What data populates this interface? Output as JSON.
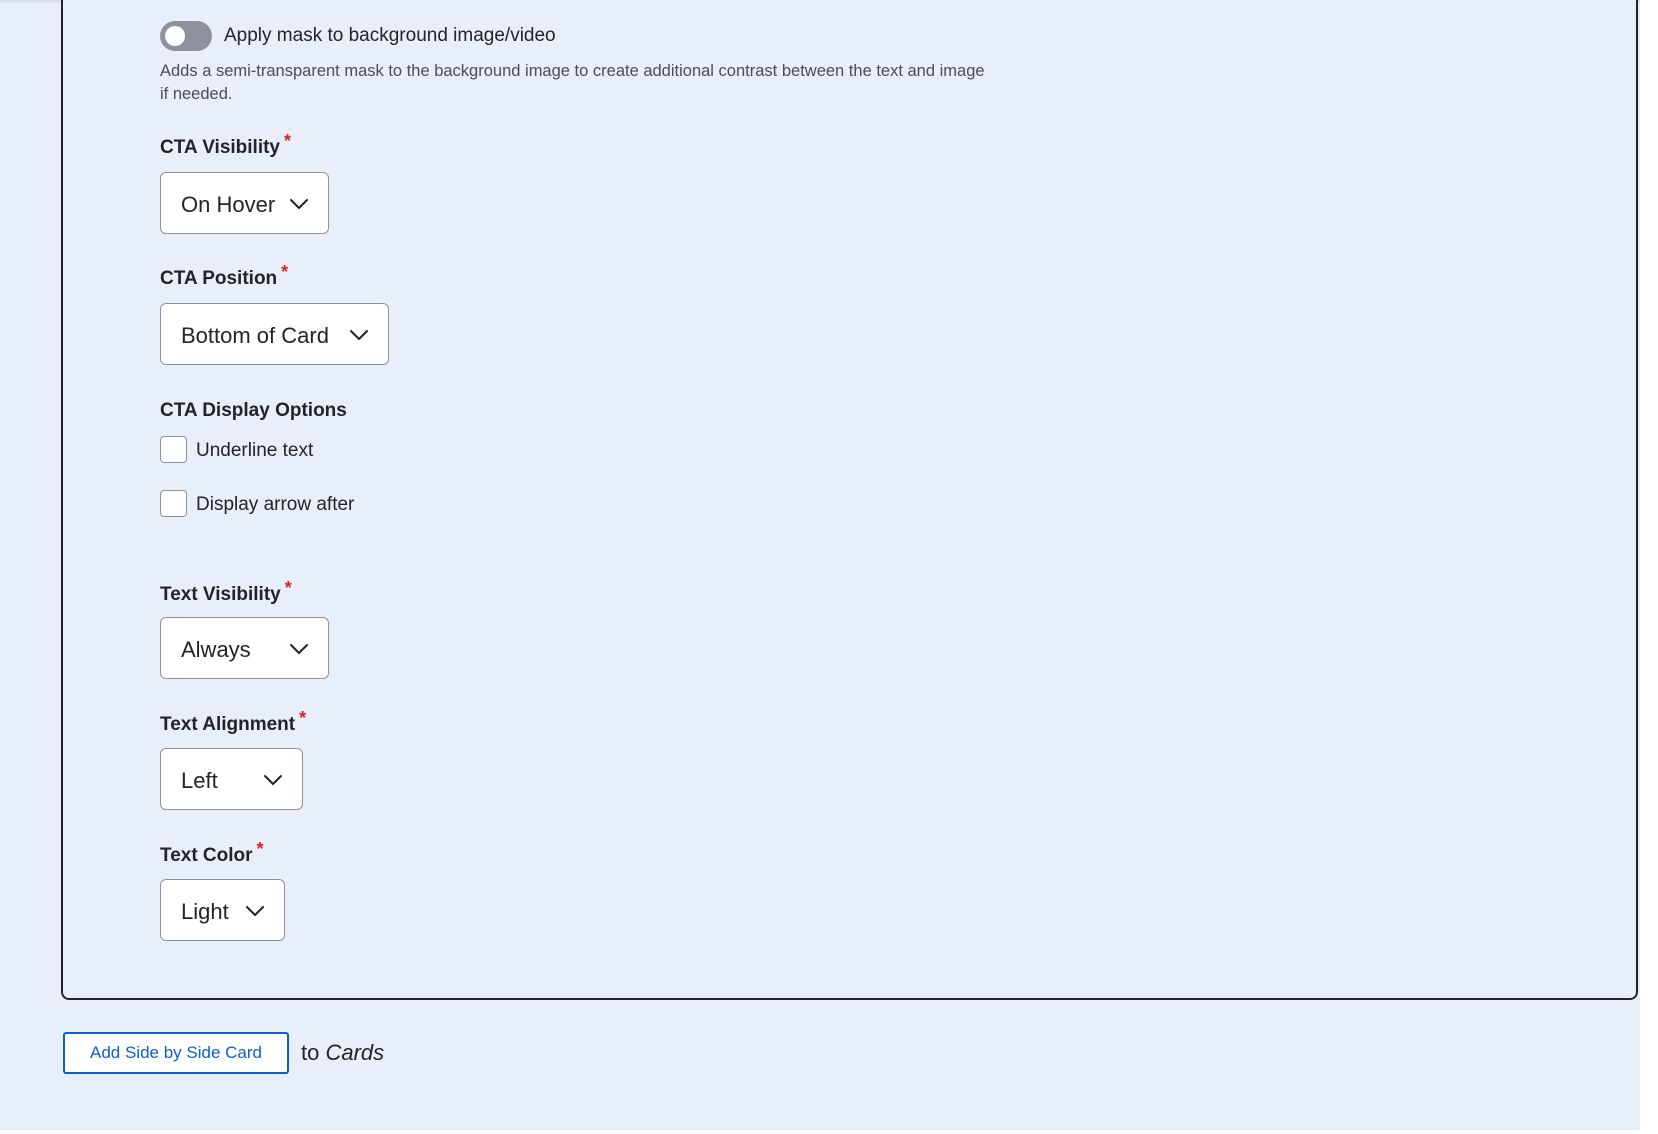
{
  "mask_toggle": {
    "label": "Apply mask to background image/video",
    "enabled": false,
    "description": "Adds a semi-transparent mask to the background image to create additional contrast between the text and image if needed."
  },
  "required_marker": "*",
  "cta_visibility": {
    "label": "CTA Visibility",
    "value": "On Hover"
  },
  "cta_position": {
    "label": "CTA Position",
    "value": "Bottom of Card"
  },
  "cta_display_options": {
    "label": "CTA Display Options",
    "options": [
      {
        "label": "Underline text",
        "checked": false
      },
      {
        "label": "Display arrow after",
        "checked": false
      }
    ]
  },
  "text_visibility": {
    "label": "Text Visibility",
    "value": "Always"
  },
  "text_alignment": {
    "label": "Text Alignment",
    "value": "Left"
  },
  "text_color": {
    "label": "Text Color",
    "value": "Light"
  },
  "add_card": {
    "button_label": "Add Side by Side Card",
    "to_text": "to",
    "target": "Cards"
  },
  "colors": {
    "background": "#e8eefa",
    "required": "#d72222",
    "accent": "#0b5fce",
    "toggle_off": "#8e929c"
  },
  "icons": {
    "select_chevron": "chevron-down-icon"
  }
}
